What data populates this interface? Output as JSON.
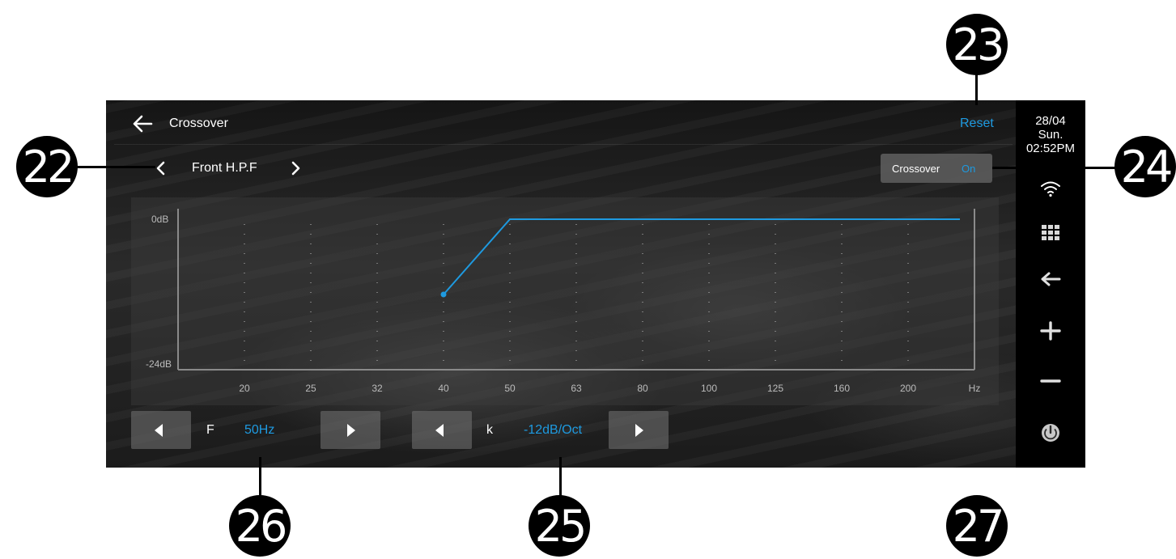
{
  "header": {
    "title": "Crossover",
    "reset_label": "Reset"
  },
  "channel": {
    "name": "Front H.P.F"
  },
  "crossover_toggle": {
    "label": "Crossover",
    "value": "On"
  },
  "status": {
    "date": "28/04",
    "day": "Sun.",
    "time": "02:52PM"
  },
  "side_icons": [
    "wifi-icon",
    "apps-grid-icon",
    "back-arrow-icon",
    "volume-up-icon",
    "volume-down-icon",
    "power-icon"
  ],
  "chart": {
    "y_top": "0dB",
    "y_bottom": "-24dB",
    "x_labels": [
      "20",
      "25",
      "32",
      "40",
      "50",
      "63",
      "80",
      "100",
      "125",
      "160",
      "200",
      "Hz"
    ],
    "curve_color": "#1e9ae0"
  },
  "chart_data": {
    "type": "line",
    "xlabel": "Hz",
    "ylabel": "",
    "categories": [
      "20",
      "25",
      "32",
      "40",
      "50",
      "63",
      "80",
      "100",
      "125",
      "160",
      "200"
    ],
    "series": [
      {
        "values": [
          null,
          null,
          null,
          -12,
          0,
          0,
          0,
          0,
          0,
          0,
          0
        ]
      }
    ],
    "ylim": [
      -24,
      0
    ],
    "grid": true
  },
  "controls": {
    "frequency": {
      "label": "F",
      "value": "50Hz"
    },
    "slope": {
      "label": "k",
      "value": "-12dB/Oct"
    }
  },
  "callouts": [
    "22",
    "23",
    "24",
    "25",
    "26",
    "27"
  ],
  "colors": {
    "accent": "#1e9ae0",
    "screen_bg": "#1e1e1e",
    "side_panel": "#000000"
  }
}
